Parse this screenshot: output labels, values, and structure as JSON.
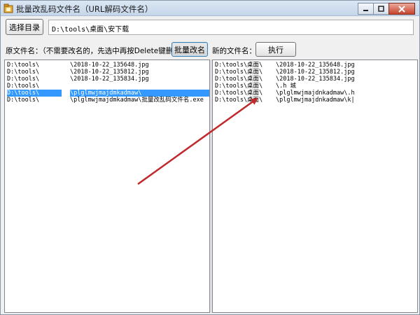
{
  "window": {
    "title": "批量改乱码文件名（URL解码文件名）"
  },
  "toolbar": {
    "select_dir_label": "选择目录",
    "path_value": "D:\\tools\\桌面\\安下载",
    "rename_label": "批量改名",
    "execute_label": "执行"
  },
  "labels": {
    "original_names": "原文件名：（不需要改名的，先选中再按Delete键删除）",
    "new_names": "新的文件名："
  },
  "left_list": [
    {
      "dir": "D:\\tools\\",
      "name": "\\2018-10-22_135648.jpg",
      "selected": false
    },
    {
      "dir": "D:\\tools\\",
      "name": "\\2018-10-22_135812.jpg",
      "selected": false
    },
    {
      "dir": "D:\\tools\\",
      "name": "\\2018-10-22_135834.jpg",
      "selected": false
    },
    {
      "dir": "D:\\tools\\",
      "name": "",
      "selected": false
    },
    {
      "dir": "D:\\tools\\",
      "name": "\\plglmwjmajdmkadmaw\\",
      "selected": true
    },
    {
      "dir": "D:\\tools\\",
      "name": "\\plglmwjmajdmkadmaw\\批量改乱码文件名.exe",
      "selected": false
    }
  ],
  "right_list": [
    {
      "dir": "D:\\tools\\桌面\\",
      "name": "\\2018-10-22_135648.jpg"
    },
    {
      "dir": "D:\\tools\\桌面\\",
      "name": "\\2018-10-22_135812.jpg"
    },
    {
      "dir": "D:\\tools\\桌面\\",
      "name": "\\2018-10-22_135834.jpg"
    },
    {
      "dir": "D:\\tools\\桌面\\",
      "name": "\\.h  城"
    },
    {
      "dir": "D:\\tools\\桌面\\",
      "name": "\\plglmwjmajdnkadmaw\\.h"
    },
    {
      "dir": "D:\\tools\\桌面\\",
      "name": "\\plglmwjmajdnkadmaw\\k|"
    }
  ],
  "colors": {
    "selection": "#3399ff",
    "arrow": "#c0282b",
    "titlebar": "#c6d6ea"
  },
  "icons": [
    "app-icon",
    "minimize-icon",
    "maximize-icon",
    "close-icon",
    "arrow-annotation"
  ]
}
